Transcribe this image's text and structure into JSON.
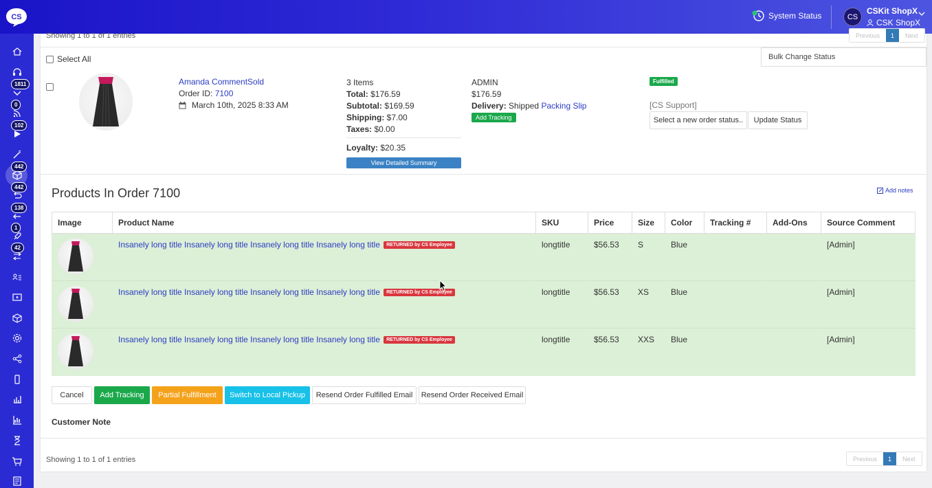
{
  "header": {
    "system_status": "System Status",
    "user_name": "CSKit ShopX",
    "user_sub": "CSK ShopX",
    "avatar_initials": "CS",
    "logo_text": "CS"
  },
  "sidebar": {
    "items": [
      {
        "icon": "home-icon"
      },
      {
        "icon": "headset-icon"
      },
      {
        "icon": "chevron-down-icon",
        "badge": "1811"
      },
      {
        "icon": "rss-icon",
        "badge": "0"
      },
      {
        "icon": "play-icon",
        "badge": "102"
      },
      {
        "icon": "magic-wand-icon"
      },
      {
        "icon": "box-icon",
        "badge": "442",
        "active": true
      },
      {
        "icon": "return-icon",
        "badge": "442"
      },
      {
        "icon": "arrow-left-icon",
        "badge": "138"
      },
      {
        "icon": "rocket-icon",
        "badge": "1"
      },
      {
        "icon": "transfer-icon",
        "badge": "42"
      },
      {
        "icon": "users-list-icon"
      },
      {
        "icon": "video-icon"
      },
      {
        "icon": "cube-icon"
      },
      {
        "icon": "settings-icon"
      },
      {
        "icon": "share-icon"
      },
      {
        "icon": "mobile-icon"
      },
      {
        "icon": "bar-chart-icon"
      },
      {
        "icon": "analytics-icon"
      },
      {
        "icon": "hourglass-icon"
      },
      {
        "icon": "cart-icon"
      },
      {
        "icon": "document-icon"
      }
    ]
  },
  "top": {
    "showing": "Showing 1 to 1 of 1 entries",
    "select_all": "Select All",
    "bulk_change": "Bulk Change Status",
    "pager": {
      "prev": "Previous",
      "page": "1",
      "next": "Next"
    }
  },
  "order": {
    "customer": "Amanda CommentSold",
    "order_id_label": "Order ID:",
    "order_id": "7100",
    "date": "March 10th, 2025 8:33 AM",
    "items_count": "3 Items",
    "total_label": "Total:",
    "total": "$176.59",
    "subtotal_label": "Subtotal:",
    "subtotal": "$169.59",
    "shipping_label": "Shipping:",
    "shipping": "$7.00",
    "taxes_label": "Taxes:",
    "taxes": "$0.00",
    "loyalty_label": "Loyalty:",
    "loyalty": "$20.35",
    "view_summary": "View Detailed Summary",
    "admin": "ADMIN",
    "admin_amount": "$176.59",
    "delivery_label": "Delivery:",
    "delivery": "Shipped",
    "packing_slip": "Packing Slip",
    "add_tracking_small": "Add Tracking",
    "status_badge": "Fulfilled",
    "cs_support": "[CS Support]",
    "status_select": "Select a new order status..",
    "update_status": "Update Status"
  },
  "products": {
    "title": "Products In Order 7100",
    "add_notes": "Add notes",
    "columns": [
      "Image",
      "Product Name",
      "SKU",
      "Price",
      "Size",
      "Color",
      "Tracking #",
      "Add-Ons",
      "Source Comment"
    ],
    "rows": [
      {
        "name": "Insanely long title Insanely long title Insanely long title Insanely long title",
        "badge": "RETURNED by CS Employee",
        "sku": "longtitle",
        "price": "$56.53",
        "size": "S",
        "color": "Blue",
        "tracking": "",
        "addons": "",
        "source": "[Admin]"
      },
      {
        "name": "Insanely long title Insanely long title Insanely long title Insanely long title",
        "badge": "RETURNED by CS Employee",
        "sku": "longtitle",
        "price": "$56.53",
        "size": "XS",
        "color": "Blue",
        "tracking": "",
        "addons": "",
        "source": "[Admin]"
      },
      {
        "name": "Insanely long title Insanely long title Insanely long title Insanely long title",
        "badge": "RETURNED by CS Employee",
        "sku": "longtitle",
        "price": "$56.53",
        "size": "XXS",
        "color": "Blue",
        "tracking": "",
        "addons": "",
        "source": "[Admin]"
      }
    ]
  },
  "actions": {
    "cancel": "Cancel",
    "add_tracking": "Add Tracking",
    "partial": "Partial Fulfillment",
    "local_pickup": "Switch to Local Pickup",
    "resend_fulfilled": "Resend Order Fulfilled Email",
    "resend_received": "Resend Order Received Email"
  },
  "customer_note": "Customer Note",
  "bottom": {
    "showing": "Showing 1 to 1 of 1 entries",
    "pager": {
      "prev": "Previous",
      "page": "1",
      "next": "Next"
    }
  },
  "colors": {
    "accent": "#2b2bd4",
    "link": "#2b3cc0",
    "row_bg": "#dcefd7",
    "success": "#1aa84b",
    "warning": "#f5a21b",
    "info": "#17c1e8",
    "danger": "#d9363e"
  }
}
